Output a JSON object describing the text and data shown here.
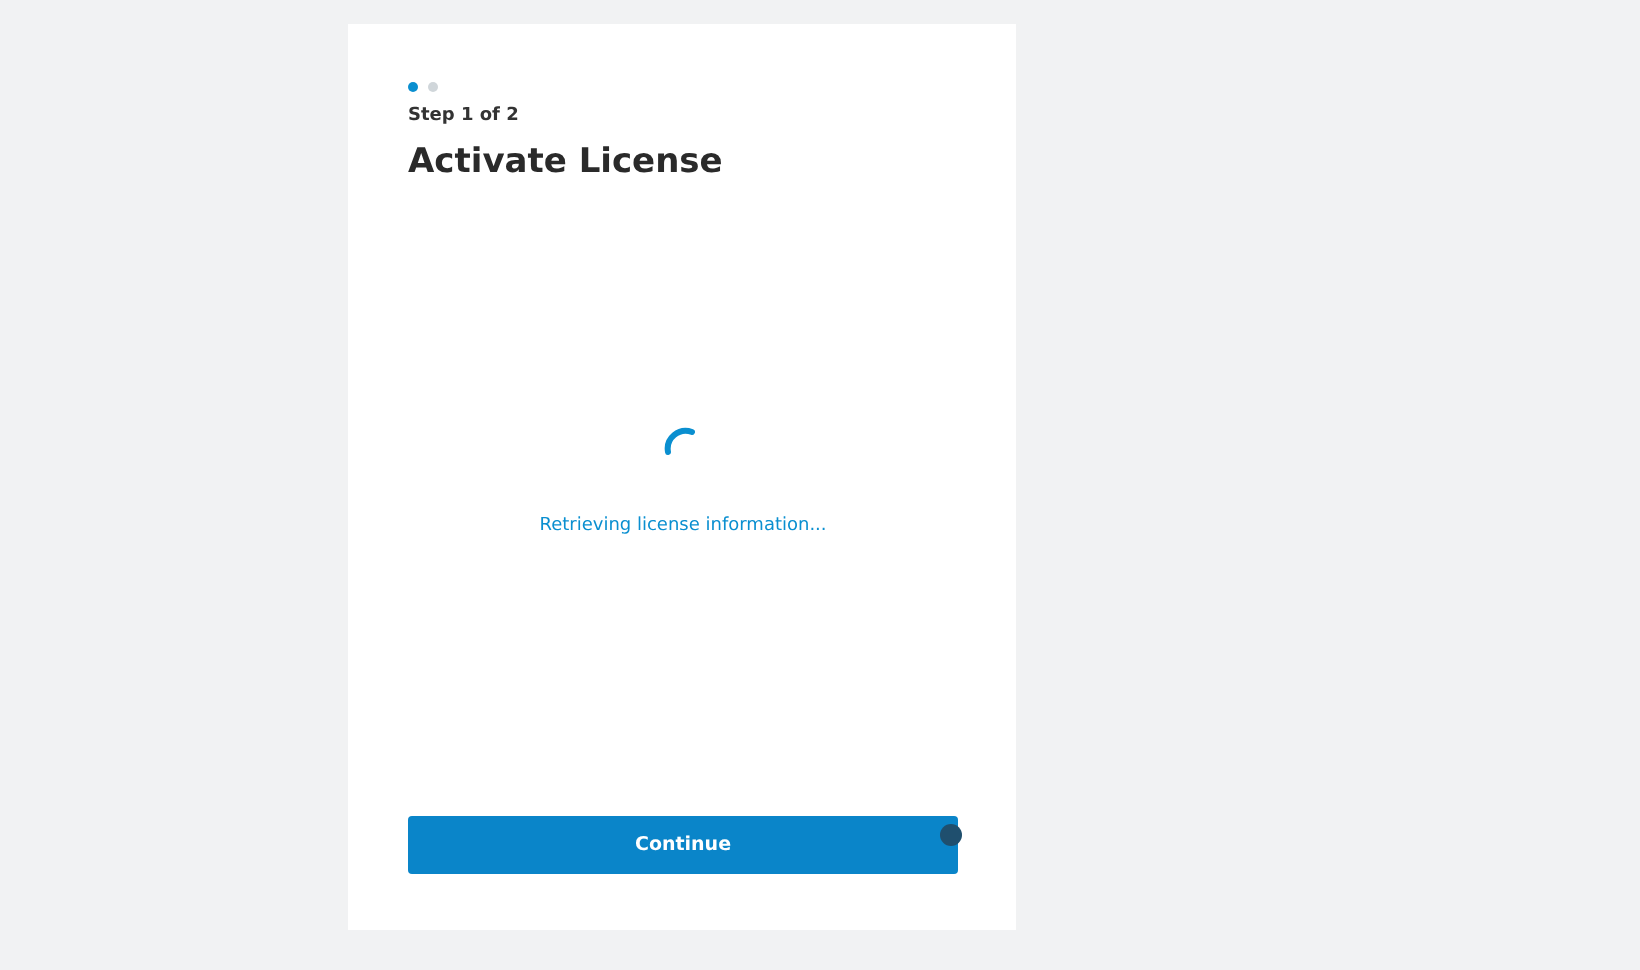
{
  "steps": [
    {
      "selected": true
    },
    {
      "selected": false
    }
  ],
  "step_label": "Step 1 of 2",
  "title": "Activate License",
  "loading": {
    "message": "Retrieving license information..."
  },
  "buttons": [
    {
      "label": "Continue"
    }
  ]
}
